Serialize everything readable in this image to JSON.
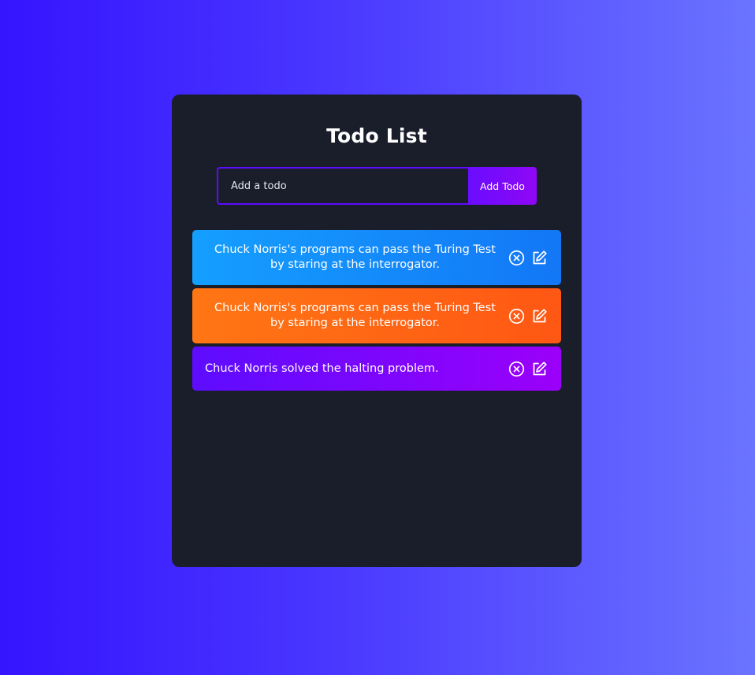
{
  "app": {
    "title": "Todo List"
  },
  "form": {
    "input_placeholder": "Add a todo",
    "input_value": "",
    "add_button_label": "Add Todo"
  },
  "todos": [
    {
      "text": "Chuck Norris's programs can pass the Turing Test by staring at the interrogator.",
      "color": "#149fff",
      "icons": [
        "close-circle-icon",
        "edit-icon"
      ]
    },
    {
      "text": "Chuck Norris's programs can pass the Turing Test by staring at the interrogator.",
      "color": "#ff7614",
      "icons": [
        "close-circle-icon",
        "edit-icon"
      ]
    },
    {
      "text": "Chuck Norris solved the halting problem.",
      "color": "#5d0cff",
      "icons": [
        "close-circle-icon",
        "edit-icon"
      ]
    }
  ],
  "colors": {
    "background_start": "#3514ff",
    "background_end": "#6b74ff",
    "panel": "#1a1d2a",
    "accent": "#5d0cff"
  }
}
